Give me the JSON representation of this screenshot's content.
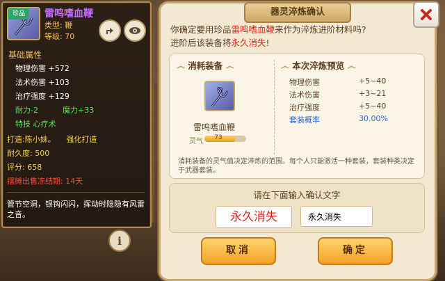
{
  "item_tooltip": {
    "rarity_tag": "珍品",
    "name": "雷鸣嗜血鞭",
    "type_label": "类型:",
    "type_value": "鞭",
    "level_label": "等级:",
    "level_value": "70",
    "base_title": "基础属性",
    "stats": [
      {
        "label": "物理伤害",
        "value": "+572"
      },
      {
        "label": "法术伤害",
        "value": "+103"
      },
      {
        "label": "治疗强度",
        "value": "+129"
      }
    ],
    "stamina": "耐力-2",
    "magic": "魔力+33",
    "special": "特技 心疗术",
    "forge_label": "打造:",
    "forge_by": "陈小妹。",
    "forge_type": "强化打造",
    "durability_label": "耐久度:",
    "durability_value": "500",
    "score_label": "评分:",
    "score_value": "658",
    "freeze_notice": "摆摊出售冻结期: 14天",
    "description": "管节空洞，银钩闪闪，挥动时隐隐有风雷之音。"
  },
  "dialog": {
    "title": "器灵淬炼确认",
    "question_prefix": "你确定要用珍品",
    "question_item": "雷鸣嗜血鞭",
    "question_suffix": "来作为淬炼进阶材料吗?",
    "question_line2_prefix": "进阶后该装备将",
    "question_line2_red": "永久消失",
    "question_line2_suffix": "!",
    "consume_header": "消耗装备",
    "preview_header": "本次淬炼预览",
    "equip_name": "雷鸣嗜血鞭",
    "spirit_label": "灵气",
    "spirit_value": "73",
    "spirit_fraction": 0.73,
    "preview_rows": [
      {
        "label": "物理伤害",
        "value": "+5~40"
      },
      {
        "label": "法术伤害",
        "value": "+3~21"
      },
      {
        "label": "治疗强度",
        "value": "+5~40"
      },
      {
        "label": "套装概率",
        "value": "30.00%"
      }
    ],
    "note": "消耗装备的灵气值决定淬炼的范围。每个人只能激活一种套装，套装种类决定于武器套装。",
    "confirm_prompt": "请在下面输入确认文字",
    "confirm_word": "永久消失",
    "confirm_input_value": "永久消失",
    "cancel_label": "取消",
    "ok_label": "确定"
  },
  "colors": {
    "accent_red": "#e0251c",
    "gold": "#f2c14e",
    "button_orange": "#f0a428"
  }
}
